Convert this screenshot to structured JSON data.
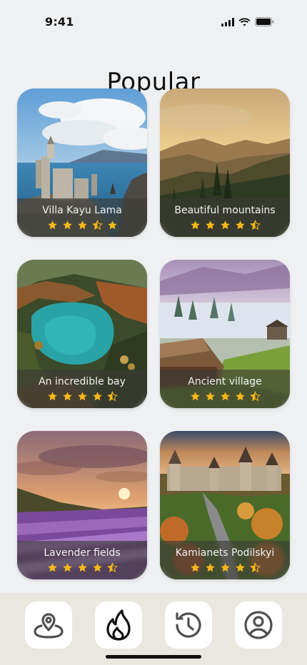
{
  "status": {
    "time": "9:41"
  },
  "page": {
    "title": "Popular"
  },
  "cards": [
    {
      "label": "Villa Kayu Lama",
      "rating": 4.5,
      "scene": "castle"
    },
    {
      "label": "Beautiful mountains",
      "rating": 4.5,
      "scene": "mountains"
    },
    {
      "label": "An incredible bay",
      "rating": 4.5,
      "scene": "bay"
    },
    {
      "label": "Ancient village",
      "rating": 4.5,
      "scene": "village"
    },
    {
      "label": "Lavender fields",
      "rating": 4.5,
      "scene": "lavender"
    },
    {
      "label": "Kamianets Podilskyi",
      "rating": 4.5,
      "scene": "fortress"
    }
  ],
  "tabs": [
    {
      "icon": "map-pin-icon",
      "active": false
    },
    {
      "icon": "flame-icon",
      "active": true
    },
    {
      "icon": "history-icon",
      "active": false
    },
    {
      "icon": "user-icon",
      "active": false
    }
  ],
  "colors": {
    "star": "#f5b718",
    "caption_bg": "#3c3a36",
    "tabbar_bg": "#e9e7df",
    "background": "#eef0f2"
  }
}
